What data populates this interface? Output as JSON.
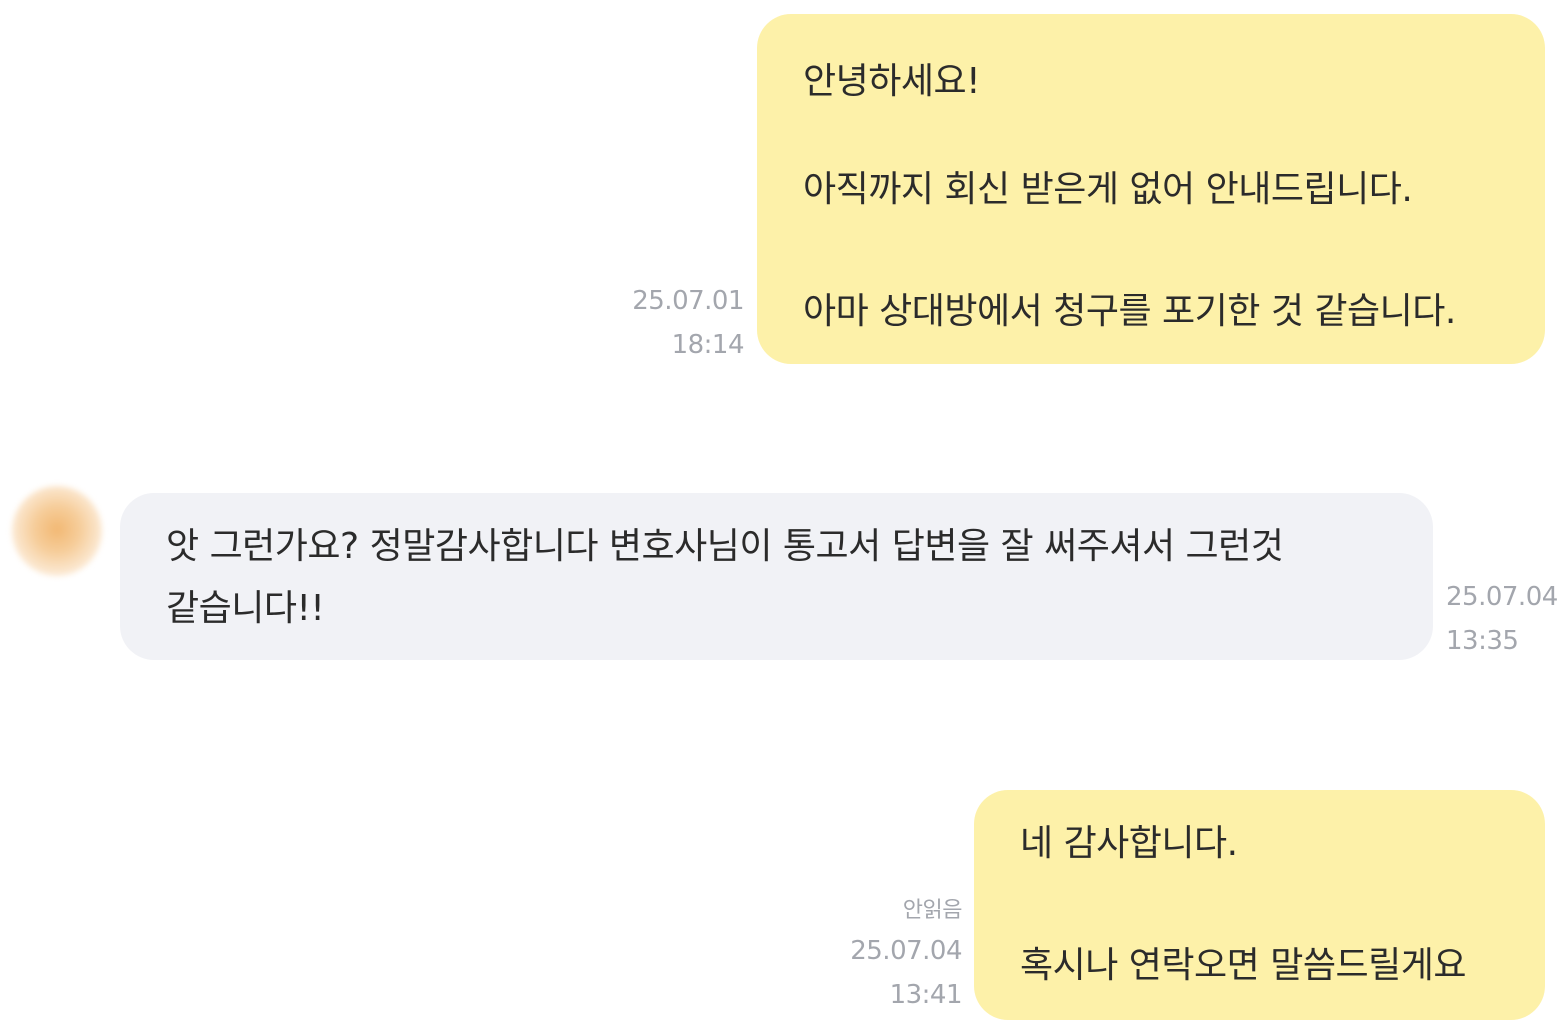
{
  "messages": [
    {
      "sender": "me",
      "lines": [
        "안녕하세요!",
        "아직까지 회신 받은게 없어 안내드립니다.",
        "아마 상대방에서 청구를 포기한 것 같습니다."
      ],
      "date": "25.07.01",
      "time": "18:14"
    },
    {
      "sender": "other",
      "lines": [
        "앗 그런가요? 정말감사합니다 변호사님이 통고서 답변을 잘 써주셔서 그런것",
        "같습니다!!"
      ],
      "date": "25.07.04",
      "time": "13:35"
    },
    {
      "sender": "me",
      "lines": [
        "네 감사합니다.",
        "혹시나 연락오면 말씀드릴게요"
      ],
      "status": "안읽음",
      "date": "25.07.04",
      "time": "13:41"
    }
  ],
  "colors": {
    "my_bubble": "#fdf1a9",
    "their_bubble": "#f1f2f6",
    "meta_text": "#a3a6ad"
  },
  "icons": {
    "avatar": "blurred-profile-avatar"
  }
}
